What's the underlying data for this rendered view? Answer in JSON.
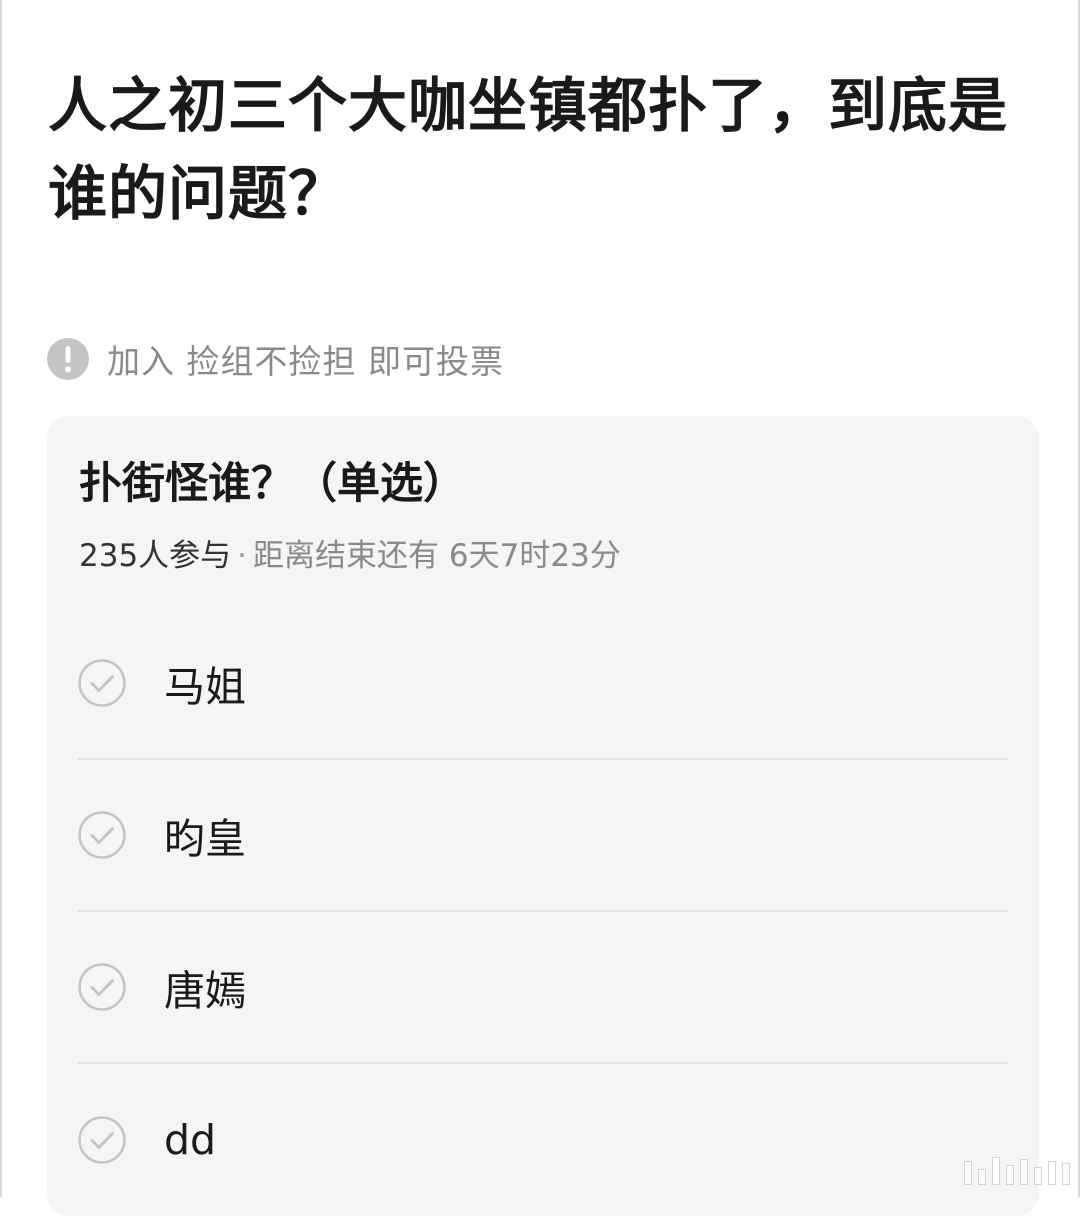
{
  "post": {
    "title": "人之初三个大咖坐镇都扑了，到底是谁的问题？"
  },
  "notice": {
    "icon": "exclamation-circle-icon",
    "text": "加入 捡组不捡担 即可投票"
  },
  "poll": {
    "title": "扑街怪谁？（单选）",
    "participants": "235人参与",
    "separator": "·",
    "time_remaining": "距离结束还有 6天7时23分",
    "options": [
      {
        "label": "马姐",
        "icon": "check-circle-icon"
      },
      {
        "label": "昀皇",
        "icon": "check-circle-icon"
      },
      {
        "label": "唐嫣",
        "icon": "check-circle-icon"
      },
      {
        "label": "dd",
        "icon": "check-circle-icon"
      }
    ]
  },
  "colors": {
    "card_background": "#f5f5f5",
    "muted_text": "#8a8a8a",
    "icon_gray": "#c4c4c4",
    "divider": "#e1e1e1"
  }
}
